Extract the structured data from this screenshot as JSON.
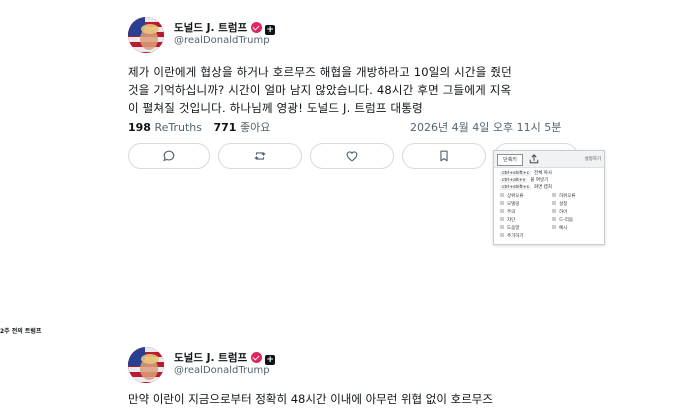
{
  "post1": {
    "author_name": "도널드 J. 트럼프",
    "author_handle": "@realDonaldTrump",
    "body_line1": "제가 이란에게 협상을 하거나 호르무즈 해협을 개방하라고 10일의 시간을 줬던",
    "body_line2": "것을 기억하십니까? 시간이 얼마 남지 않았습니다. 48시간 후면 그들에게 지옥",
    "body_line3": "이 펼쳐질 것입니다. 하나님께 영광! 도널드 J. 트럼프 대통령",
    "retruths_count": "198",
    "retruths_label": "ReTruths",
    "likes_count": "771",
    "likes_label": "좋아요",
    "timestamp": "2026년 4월 4일 오후 11시 5분"
  },
  "context_menu": {
    "tab_label": "단축키",
    "header_right": "설정하기",
    "row1_key": "ctrl+shift+c",
    "row1_label": "전체 복사",
    "row2_key": "ctrl+alt+v",
    "row2_label": "붙 여넣기",
    "row3_key": "ctrl+shift+s",
    "row3_label": "화면 캡처",
    "cells": [
      "상위오류",
      "하위오류",
      "모델링",
      "주의",
      "하이",
      "차단",
      "설정",
      "드-리움",
      "도움말",
      "예시",
      "추가하기"
    ]
  },
  "section_label": "2주 전의 트럼프",
  "post2": {
    "author_name": "도널드 J. 트럼프",
    "author_handle": "@realDonaldTrump",
    "body_line1": "만약 이란이 지금으로부터 정확히 48시간 이내에 아무런 위협 없이 호르무즈"
  },
  "colors": {
    "verified_badge": "#e0245e",
    "muted_text": "#536471",
    "border": "#d6dbe0"
  },
  "icons": [
    "reply-icon",
    "retruth-icon",
    "like-icon",
    "bookmark-icon",
    "share-icon",
    "verified-icon"
  ]
}
